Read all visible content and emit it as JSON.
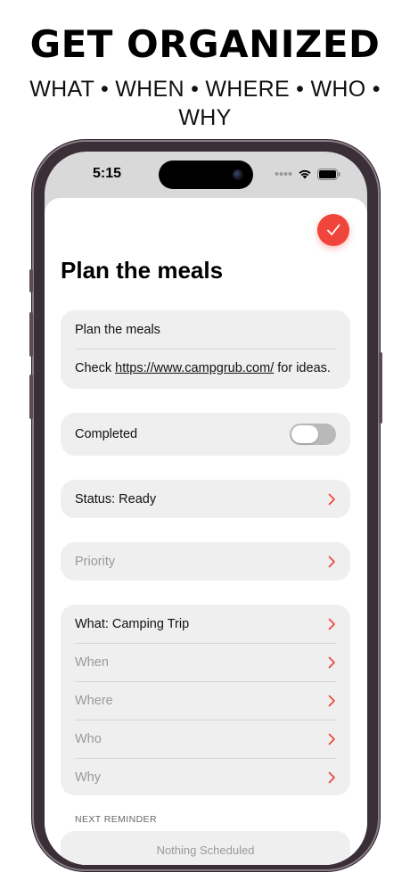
{
  "marketing": {
    "headline": "GET ORGANIZED",
    "tagline": "WHAT • WHEN • WHERE • WHO • WHY"
  },
  "status_bar": {
    "time": "5:15",
    "icons": [
      "signal-dots-icon",
      "wifi-icon",
      "battery-icon"
    ]
  },
  "task": {
    "title": "Plan the meals",
    "notes_title": "Plan the meals",
    "notes_prefix": "Check ",
    "notes_link": "https://www.campgrub.com/",
    "notes_suffix": " for ideas.",
    "completed_label": "Completed",
    "completed": false,
    "status_label": "Status: Ready",
    "priority_placeholder": "Priority",
    "what_label": "What: Camping Trip",
    "when_placeholder": "When",
    "where_placeholder": "Where",
    "who_placeholder": "Who",
    "why_placeholder": "Why"
  },
  "reminder": {
    "section_label": "NEXT REMINDER",
    "value": "Nothing Scheduled"
  },
  "colors": {
    "accent": "#f0453a",
    "card_background": "#efefef",
    "placeholder_text": "#9a9a9a"
  }
}
